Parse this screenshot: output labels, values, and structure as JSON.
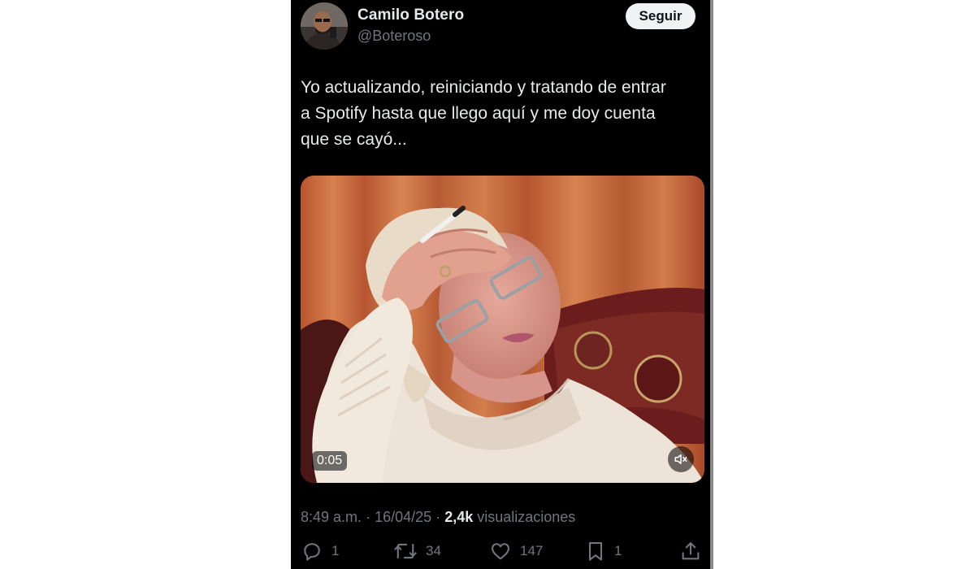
{
  "tweet": {
    "author_name": "Camilo Botero",
    "author_handle": "@Boteroso",
    "follow_label": "Seguir",
    "text": "Yo actualizando, reiniciando y tratando de entrar\na Spotify hasta que llego aquí y me doy cuenta\nque se cayó...",
    "video_duration": "0:05",
    "time": "8:49 a.m.",
    "separator": "·",
    "date": "16/04/25",
    "views_count": "2,4k",
    "views_label": "visualizaciones"
  },
  "actions": {
    "replies": "1",
    "retweets": "34",
    "likes": "147",
    "bookmarks": "1"
  },
  "icons": {
    "reply": "reply-icon",
    "retweet": "retweet-icon",
    "like": "heart-icon",
    "bookmark": "bookmark-icon",
    "share": "share-icon",
    "mute": "volume-muted-icon"
  },
  "colors": {
    "background": "#000000",
    "text_primary": "#e7e9ea",
    "text_secondary": "#71767b",
    "follow_button_bg": "#eff3f4"
  }
}
